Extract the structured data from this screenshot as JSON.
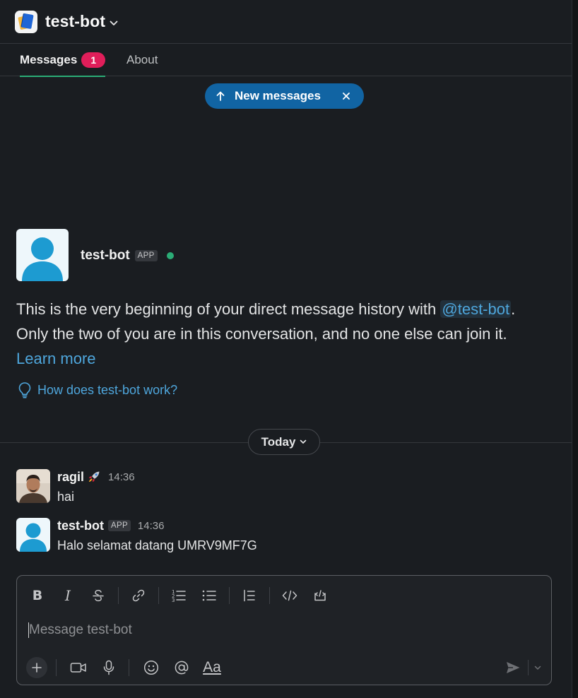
{
  "header": {
    "title": "test-bot"
  },
  "tabs": [
    {
      "label": "Messages",
      "badge": "1"
    },
    {
      "label": "About"
    }
  ],
  "new_messages_pill": {
    "label": "New messages"
  },
  "intro": {
    "name": "test-bot",
    "badge": "APP",
    "line_prefix": "This is the very beginning of your direct message history with ",
    "mention": "@test-bot",
    "line_suffix": ".",
    "line2": "Only the two of you are in this conversation, and no one else can join it.",
    "learn_more": "Learn more",
    "how_link": "How does test-bot work?"
  },
  "date_divider": {
    "label": "Today"
  },
  "messages": [
    {
      "author": "ragil",
      "status_emoji": "rocket-emoji",
      "time": "14:36",
      "text": "hai"
    },
    {
      "author": "test-bot",
      "badge": "APP",
      "time": "14:36",
      "text": "Halo selamat datang UMRV9MF7G"
    }
  ],
  "composer": {
    "placeholder": "Message test-bot",
    "format_label": "Aa",
    "toolbar_icons": [
      "bold-icon",
      "italic-icon",
      "strikethrough-icon",
      "link-icon",
      "ordered-list-icon",
      "bulleted-list-icon",
      "blockquote-icon",
      "code-icon",
      "code-block-icon"
    ],
    "action_icons": [
      "plus-icon",
      "video-icon",
      "microphone-icon",
      "emoji-icon",
      "mention-icon",
      "format-icon",
      "send-icon",
      "chevron-down-icon"
    ]
  },
  "colors": {
    "background": "#1a1d21",
    "accent_link": "#4ea6dc",
    "badge_red": "#e01e5a",
    "presence_green": "#2bac76",
    "pill_blue": "#1164a3"
  }
}
